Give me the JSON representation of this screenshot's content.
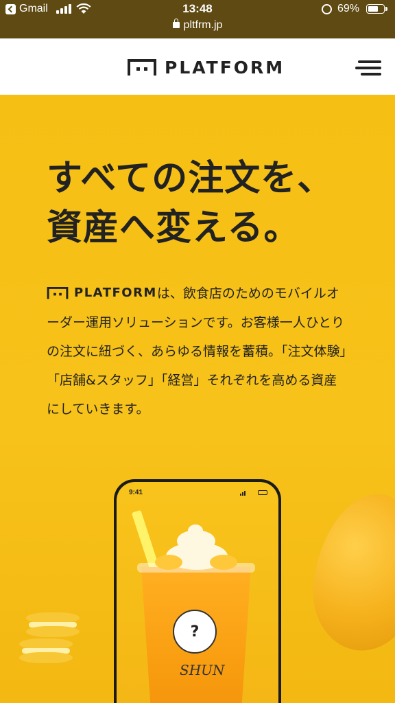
{
  "status_bar": {
    "back_app": "Gmail",
    "time": "13:48",
    "url": "pltfrm.jp",
    "battery_percent": "69%",
    "battery_level": 0.69
  },
  "header": {
    "logo_text": "PLATFORM",
    "menu_icon": "hamburger-menu-icon"
  },
  "hero": {
    "headline_line1": "すべての注文を、",
    "headline_line2": "資産へ変える。",
    "intro_logo_text": "PLATFORM",
    "intro_text": "は、飲食店のためのモバイルオーダー運用ソリューションです。お客様一人ひとりの注文に紐づく、あらゆる情報を蓄積。「注文体験」「店舗&スタッフ」「経営」それぞれを高める資産にしていきます。"
  },
  "phone": {
    "time": "9:41",
    "label_glyph": "?",
    "sign_text": "SHUN"
  },
  "colors": {
    "accent_yellow": "#f7bf14",
    "status_bar": "#5e4a12",
    "text": "#222222"
  }
}
